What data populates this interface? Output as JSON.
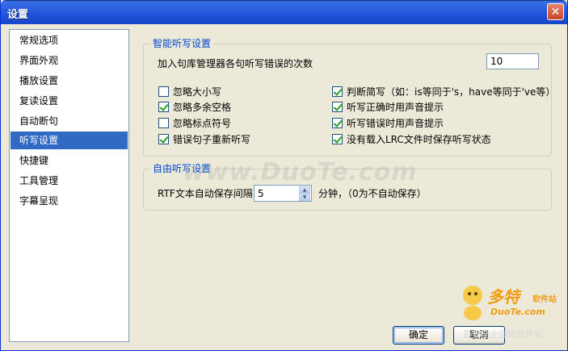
{
  "window": {
    "title": "设置",
    "close_label": "✕"
  },
  "sidebar": {
    "items": [
      {
        "label": "常规选项",
        "selected": false
      },
      {
        "label": "界面外观",
        "selected": false
      },
      {
        "label": "播放设置",
        "selected": false
      },
      {
        "label": "复读设置",
        "selected": false
      },
      {
        "label": "自动断句",
        "selected": false
      },
      {
        "label": "听写设置",
        "selected": true
      },
      {
        "label": "快捷键",
        "selected": false
      },
      {
        "label": "工具管理",
        "selected": false
      },
      {
        "label": "字幕呈现",
        "selected": false
      }
    ]
  },
  "smart_group": {
    "title": "智能听写设置",
    "error_count_label": "加入句库管理器各句听写错误的次数",
    "error_count_value": "10",
    "options": [
      {
        "label": "忽略大小写",
        "checked": false
      },
      {
        "label": "忽略多余空格",
        "checked": true
      },
      {
        "label": "忽略标点符号",
        "checked": false
      },
      {
        "label": "错误句子重新听写",
        "checked": true
      },
      {
        "label": "判断简写（如：is等同于's，have等同于've等）",
        "checked": true
      },
      {
        "label": "听写正确时用声音提示",
        "checked": true
      },
      {
        "label": "听写错误时用声音提示",
        "checked": true
      },
      {
        "label": "没有载入LRC文件时保存听写状态",
        "checked": true
      }
    ]
  },
  "free_group": {
    "title": "自由听写设置",
    "autosave_label": "RTF文本自动保存间隔",
    "autosave_value": "5",
    "autosave_suffix": "分钟，（0为不自动保存）"
  },
  "footer": {
    "ok_label": "确定",
    "cancel_label": "取消"
  },
  "overlay": {
    "watermark": "www.DuoTe.com",
    "logo_cn": "多特",
    "logo_sub": "软件站",
    "logo_en": "DuoTe.com",
    "logo_slogan": "最安全全面的软件站"
  }
}
